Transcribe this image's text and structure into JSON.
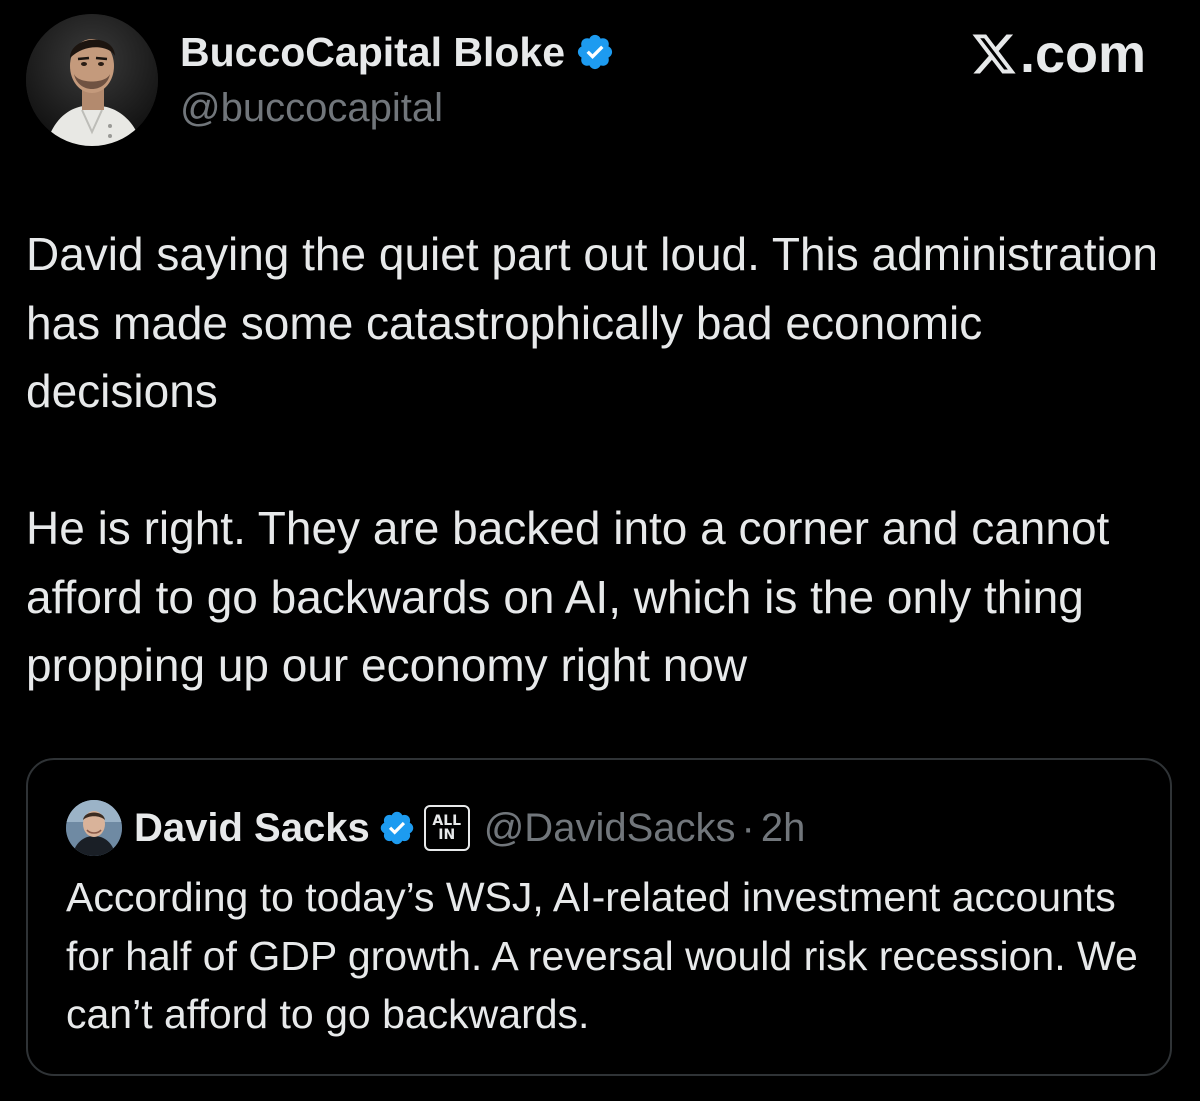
{
  "brand": {
    "label": ".com",
    "icon": "x-logo-icon"
  },
  "author": {
    "name": "BuccoCapital Bloke",
    "handle": "@buccocapital",
    "verified_icon": "verified-badge-icon",
    "avatar_icon": "avatar"
  },
  "tweet": {
    "paragraphs": [
      "David saying the quiet part out loud. This administration has made some catastrophically bad economic decisions",
      "He is right. They are backed into a corner and cannot afford to go backwards on AI, which is the only thing propping up our economy right now"
    ]
  },
  "quote": {
    "name": "David Sacks",
    "handle": "@DavidSacks",
    "dot": "·",
    "time": "2h",
    "affiliate_top": "ALL",
    "affiliate_bottom": "IN",
    "text": "According to today’s WSJ, AI-related investment accounts for half of GDP growth. A reversal would risk recession. We can’t afford to go backwards."
  },
  "colors": {
    "background": "#000000",
    "text_primary": "#e7e9ea",
    "text_secondary": "#71767b",
    "verified_blue": "#1d9bf0",
    "border": "#2f3336"
  }
}
